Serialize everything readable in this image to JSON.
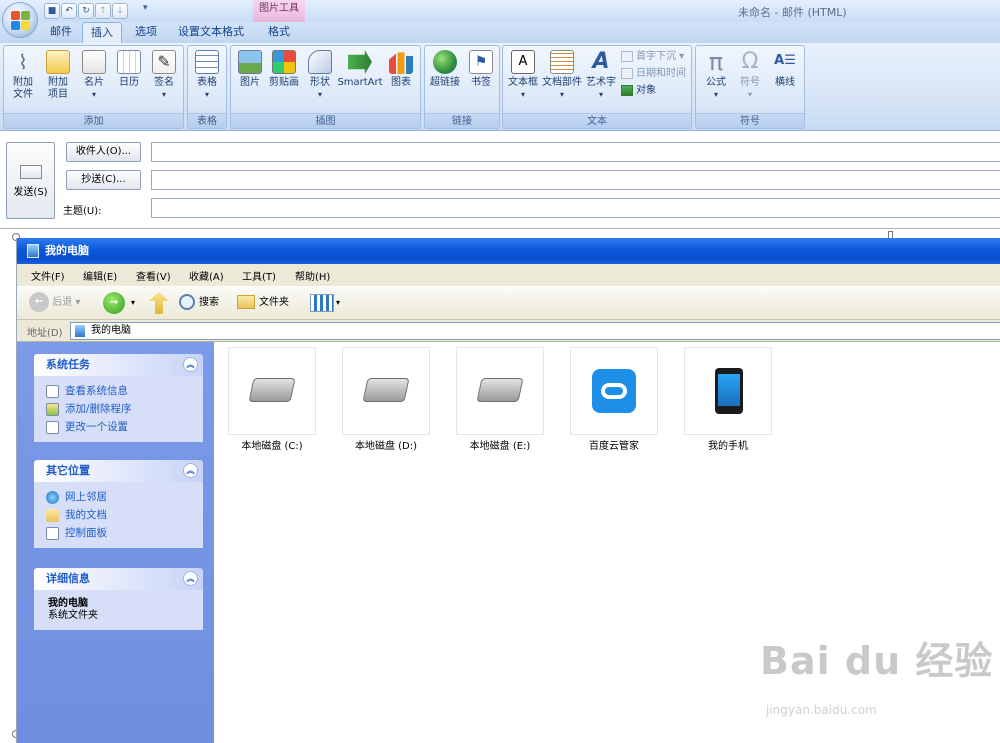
{
  "window": {
    "title": "未命名 - 邮件 (HTML)",
    "tool_context": "图片工具"
  },
  "tabs": [
    {
      "label": "邮件"
    },
    {
      "label": "插入"
    },
    {
      "label": "选项"
    },
    {
      "label": "设置文本格式"
    },
    {
      "label": "格式"
    }
  ],
  "active_tab": "插入",
  "ribbon": {
    "add": {
      "label": "添加",
      "attach_file_1": "附加",
      "attach_file_2": "文件",
      "attach_item_1": "附加",
      "attach_item_2": "项目",
      "card": "名片",
      "calendar": "日历",
      "signature": "签名"
    },
    "table": {
      "label": "表格",
      "table": "表格"
    },
    "illustrations": {
      "label": "插图",
      "picture": "图片",
      "clipart": "剪贴画",
      "shapes": "形状",
      "smartart": "SmartArt",
      "chart": "图表"
    },
    "links": {
      "label": "链接",
      "hyperlink": "超链接",
      "bookmark": "书签"
    },
    "text": {
      "label": "文本",
      "textbox": "文本框",
      "quickparts": "文档部件",
      "wordart": "艺术字",
      "dropcap": "首字下沉",
      "datetime": "日期和时间",
      "object": "对象"
    },
    "symbols": {
      "label": "符号",
      "equation": "公式",
      "symbol": "符号",
      "hline": "横线"
    }
  },
  "header": {
    "send": "发送(S)",
    "to": "收件人(O)...",
    "cc": "抄送(C)...",
    "subject": "主题(U):"
  },
  "explorer": {
    "title": "我的电脑",
    "menu": [
      "文件(F)",
      "编辑(E)",
      "查看(V)",
      "收藏(A)",
      "工具(T)",
      "帮助(H)"
    ],
    "toolbar": {
      "back": "后退",
      "search": "搜索",
      "folders": "文件夹"
    },
    "address_label": "地址(D)",
    "address_value": "我的电脑",
    "panels": {
      "system_tasks": {
        "title": "系统任务",
        "items": [
          "查看系统信息",
          "添加/删除程序",
          "更改一个设置"
        ]
      },
      "other_places": {
        "title": "其它位置",
        "items": [
          "网上邻居",
          "我的文档",
          "控制面板"
        ]
      },
      "details": {
        "title": "详细信息",
        "name": "我的电脑",
        "type": "系统文件夹"
      }
    },
    "items": [
      {
        "label": "本地磁盘 (C:)"
      },
      {
        "label": "本地磁盘 (D:)"
      },
      {
        "label": "本地磁盘 (E:)"
      },
      {
        "label": "百度云管家"
      },
      {
        "label": "我的手机"
      }
    ]
  },
  "watermark": {
    "main": "Bai du 经验",
    "sub": "jingyan.baidu.com"
  },
  "colors": {
    "ribbon_text": "#15428b",
    "xp_title": "#0b57d9",
    "xp_pane": "#7b9be8",
    "baidu_blue": "#1e8fe6"
  }
}
